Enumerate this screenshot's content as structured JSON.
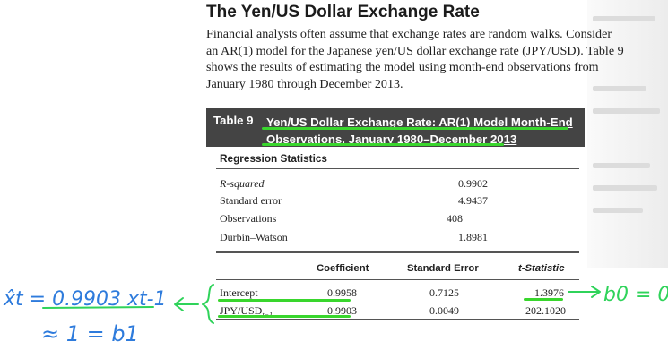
{
  "section_title": "The Yen/US Dollar Exchange Rate",
  "paragraph_lines": [
    "Financial analysts often assume that exchange rates are random walks. Consider",
    "an AR(1) model for the Japanese yen/US dollar exchange rate (JPY/USD). Table 9",
    "shows the results of estimating the model using month-end observations from",
    "January 1980 through December 2013."
  ],
  "table": {
    "number": "Table 9",
    "caption_line1": "Yen/US Dollar Exchange Rate: AR(1) Model Month-End",
    "caption_line2": "Observations, January 1980–December 2013",
    "regression_title": "Regression Statistics",
    "stats": [
      {
        "label": "R-squared",
        "value": "0.9902"
      },
      {
        "label": "Standard error",
        "value": "4.9437"
      },
      {
        "label": "Observations",
        "value": "408"
      },
      {
        "label": "Durbin–Watson",
        "value": "1.8981"
      }
    ],
    "columns": {
      "coefficient": "Coefficient",
      "std_error": "Standard Error",
      "t_stat": "t-Statistic"
    },
    "rows": [
      {
        "label": "Intercept",
        "label_sub": "",
        "coefficient": "0.9958",
        "std_error": "0.7125",
        "t_stat": "1.3976"
      },
      {
        "label": "JPY/USD",
        "label_sub": "t−1",
        "coefficient": "0.9903",
        "std_error": "0.0049",
        "t_stat": "202.1020"
      }
    ]
  },
  "handwritten_notes": {
    "left_equation_line1": "x̂t = 0.9903 xt-1",
    "left_equation_line2": "≈ 1 = b1",
    "right_note": "b0 = 0",
    "highlight_color": "#39d62d",
    "ink_color": "#2fd35a"
  }
}
